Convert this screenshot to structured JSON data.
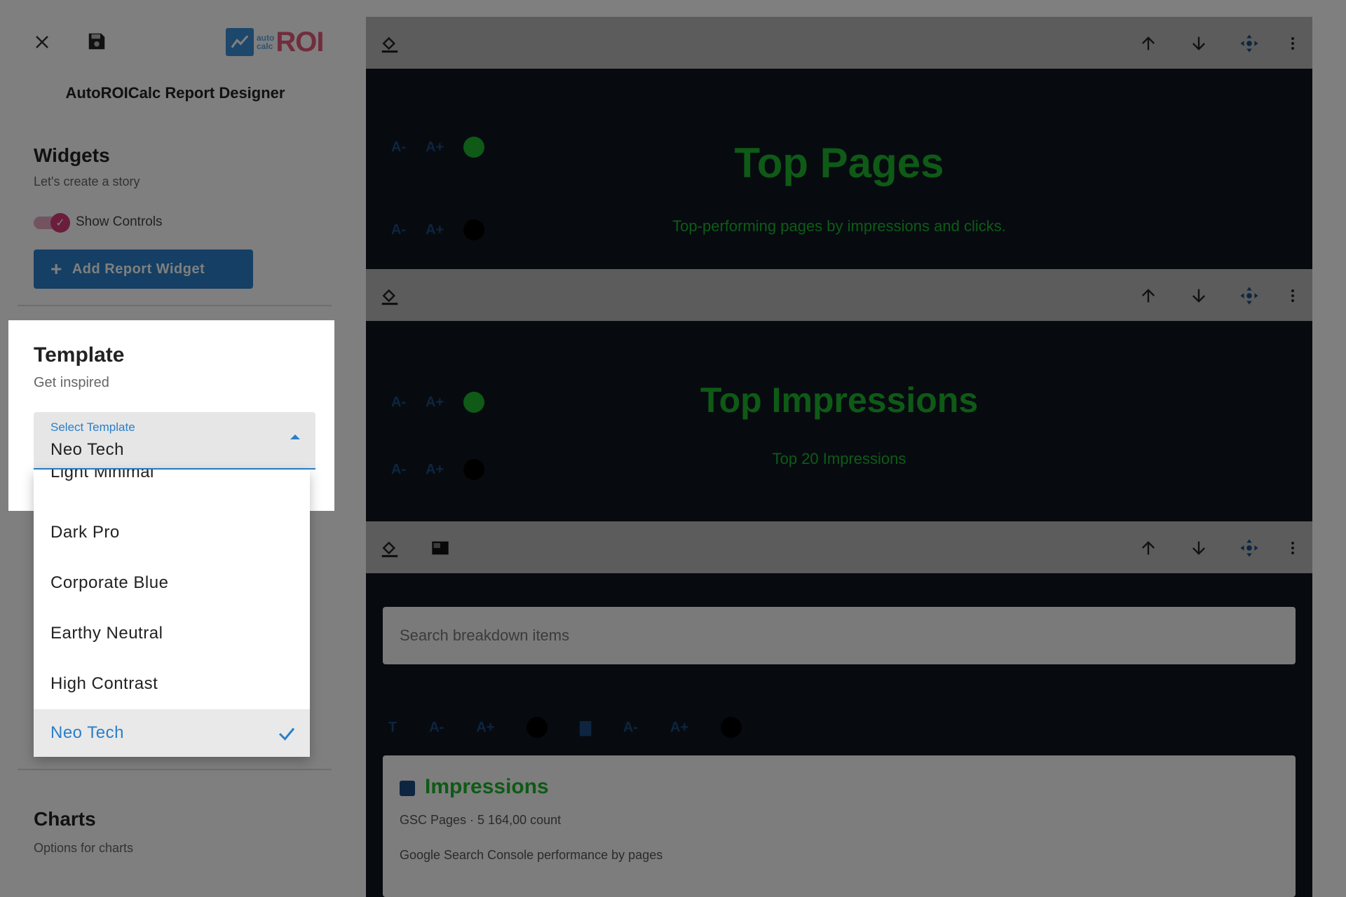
{
  "app": {
    "title": "AutoROICalc Report Designer",
    "logo_small": "auto\ncalc",
    "logo_text": "ROI"
  },
  "widgets_panel": {
    "title": "Widgets",
    "subtitle": "Let's create a story",
    "toggle_label": "Show Controls",
    "toggle_on": true,
    "add_button": "Add Report Widget"
  },
  "template_panel": {
    "title": "Template",
    "subtitle": "Get inspired",
    "select_label": "Select Template",
    "selected_value": "Neo Tech",
    "options": [
      {
        "label": "Light Minimal",
        "selected": false
      },
      {
        "label": "Dark Pro",
        "selected": false
      },
      {
        "label": "Corporate Blue",
        "selected": false
      },
      {
        "label": "Earthy Neutral",
        "selected": false
      },
      {
        "label": "High Contrast",
        "selected": false
      },
      {
        "label": "Neo Tech",
        "selected": true
      }
    ]
  },
  "charts_panel": {
    "title": "Charts",
    "subtitle": "Options for charts"
  },
  "canvas": {
    "widgets": [
      {
        "title": "Top Pages",
        "subtitle": "Top-performing pages by impressions and clicks."
      },
      {
        "title": "Top Impressions",
        "subtitle": "Top 20 Impressions"
      }
    ],
    "search_placeholder": "Search breakdown items",
    "breakdown_card": {
      "title": "Impressions",
      "meta": "GSC Pages · 5 164,00 count",
      "description": "Google Search Console performance by pages"
    },
    "ctrl_labels": {
      "a_minus": "A-",
      "a_plus": "A+",
      "t": "T"
    }
  },
  "colors": {
    "accent": "#2a7fc9",
    "toggle": "#d63b78",
    "neo_green": "#1db52c",
    "canvas_bg": "#0f1620"
  }
}
